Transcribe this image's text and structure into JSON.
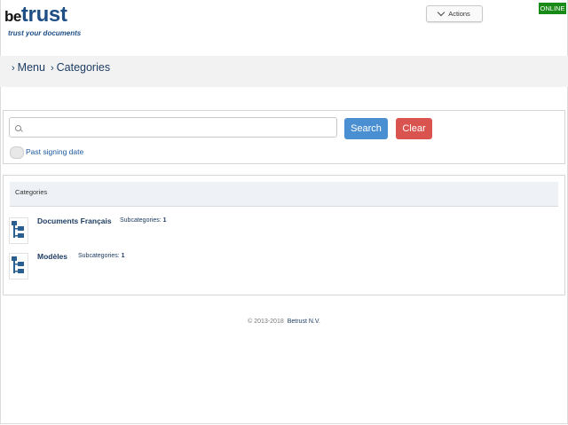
{
  "header": {
    "logo_be": "be",
    "logo_trust": "trust",
    "tagline": "trust your documents",
    "actions_label": "Actions",
    "status_badge": "ONLINE"
  },
  "breadcrumb": {
    "items": [
      "Menu",
      "Categories"
    ]
  },
  "search": {
    "value": "",
    "placeholder": "",
    "search_label": "Search",
    "clear_label": "Clear",
    "past_signing_label": "Past signing date"
  },
  "categories": {
    "title": "Categories",
    "subcategories_label": "Subcategories:",
    "items": [
      {
        "name": "Documents Français",
        "subcategories": "1"
      },
      {
        "name": "Modèles",
        "subcategories": "1"
      }
    ]
  },
  "footer": {
    "copyright": "© 2013-2018",
    "company": "Betrust N.V."
  },
  "colors": {
    "brand": "#1e4e84",
    "search_button": "#4a8fd1",
    "clear_button": "#d9534f",
    "online": "#178a17"
  }
}
